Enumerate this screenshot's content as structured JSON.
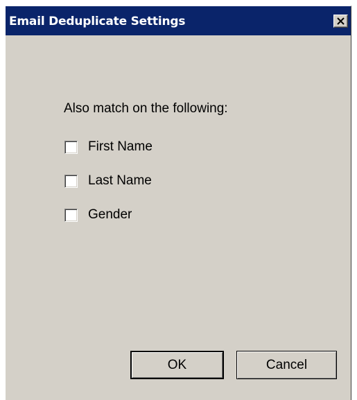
{
  "window": {
    "title": "Email Deduplicate Settings",
    "close_icon": "close-icon"
  },
  "main": {
    "prompt": "Also match on the following:",
    "checkboxes": [
      {
        "label": "First Name",
        "checked": false
      },
      {
        "label": "Last Name",
        "checked": false
      },
      {
        "label": "Gender",
        "checked": false
      }
    ]
  },
  "buttons": {
    "ok_label": "OK",
    "cancel_label": "Cancel"
  },
  "colors": {
    "titlebar": "#0a246a",
    "dialog_bg": "#d4d0c8"
  }
}
